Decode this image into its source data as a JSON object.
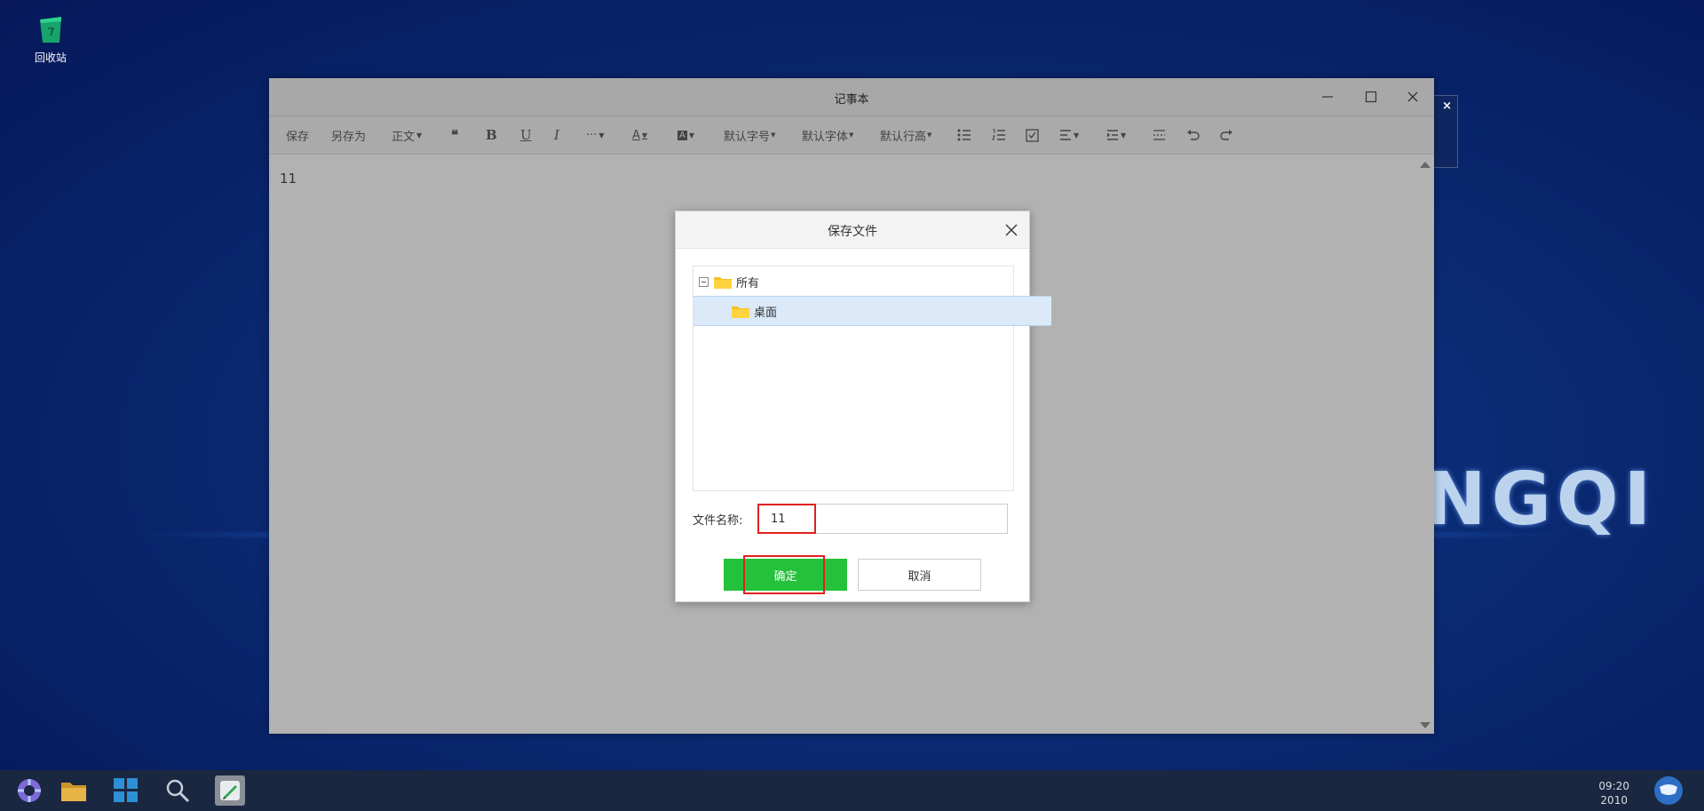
{
  "desktop": {
    "icons": [
      {
        "label": "回收站",
        "icon": "recycle-bin-icon"
      }
    ],
    "brand_text": "NGQI"
  },
  "notepad": {
    "title": "记事本",
    "toolbar": {
      "save": "保存",
      "save_as": "另存为",
      "style": "正文",
      "quote_icon": "❝",
      "bold": "B",
      "underline": "U",
      "italic": "I",
      "more": "···",
      "font_color": "A",
      "bg_color": "A",
      "font_size": "默认字号",
      "font_family": "默认字体",
      "line_height": "默认行高"
    },
    "content": "11"
  },
  "dialog": {
    "title": "保存文件",
    "tree": {
      "root": "所有",
      "child": "桌面"
    },
    "filename_label": "文件名称:",
    "filename_value": "11",
    "ok": "确定",
    "cancel": "取消"
  },
  "taskbar": {
    "time": "09:20",
    "date": "2010"
  },
  "colors": {
    "ok_button": "#23c23a",
    "highlight": "#e02020",
    "selected_row": "#dbe9f8"
  }
}
